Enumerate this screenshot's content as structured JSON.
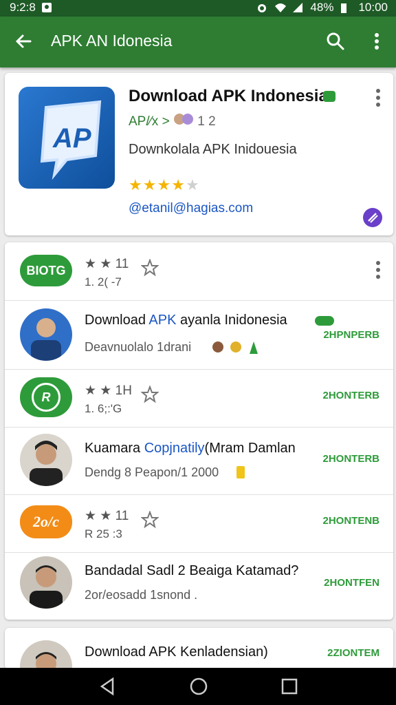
{
  "status": {
    "left_text": "9:2:8",
    "battery": "48%",
    "time": "10:00"
  },
  "appbar": {
    "title": "APK AN Idonesia"
  },
  "hero": {
    "title": "Download APK Indonesia",
    "developer": "AP/⁄x > ",
    "developer_count": "1 2",
    "description": "Downkolala APK Inidouesia",
    "rating_stars": 4,
    "email": "@etanil@hagias.com",
    "icon_text": "AP"
  },
  "list": {
    "rows": [
      {
        "type": "badge",
        "badge": "BIOTG",
        "badge_color": "#2e9b3a",
        "rating": "★ ★ 11",
        "sub": "1. 2( -7",
        "action": ""
      },
      {
        "type": "person",
        "name_prefix": "Download ",
        "name_blue": "APK",
        "name_suffix": " ayanla Inidonesia",
        "desc": "Deavnuolalo 1drani",
        "action": "2HPNPERB"
      },
      {
        "type": "badge",
        "badge": "R",
        "badge_color": "#2e9b3a",
        "rating": "★ ★ 1H",
        "sub": "1. 6;:'G",
        "action": "2HONTERB"
      },
      {
        "type": "person",
        "name_prefix": "Kuamara ",
        "name_blue": "Copjnatily",
        "name_suffix": "(Mram Damlan",
        "desc": "Dendg 8 Peapon/1 2000",
        "action": "2HONTERB"
      },
      {
        "type": "badge",
        "badge": "2o/c",
        "badge_color": "#f28c17",
        "rating": "★ ★ 11",
        "sub": "R 25 :3",
        "action": "2HONTENB"
      },
      {
        "type": "person",
        "name_prefix": "Bandadal Sadl",
        "name_blue": "",
        "name_suffix": " 2 Beaiga Katamad?",
        "desc": "2or/eosadd 1snond .",
        "action": "2HONTFEN"
      }
    ]
  },
  "partial_row": {
    "name": "Download APK Kenladensian)",
    "action": "2ZIONTEM"
  },
  "colors": {
    "primary": "#2e7d32",
    "status": "#1e5a26",
    "accent_green": "#2e9b3a",
    "link_blue": "#1a56c4"
  }
}
